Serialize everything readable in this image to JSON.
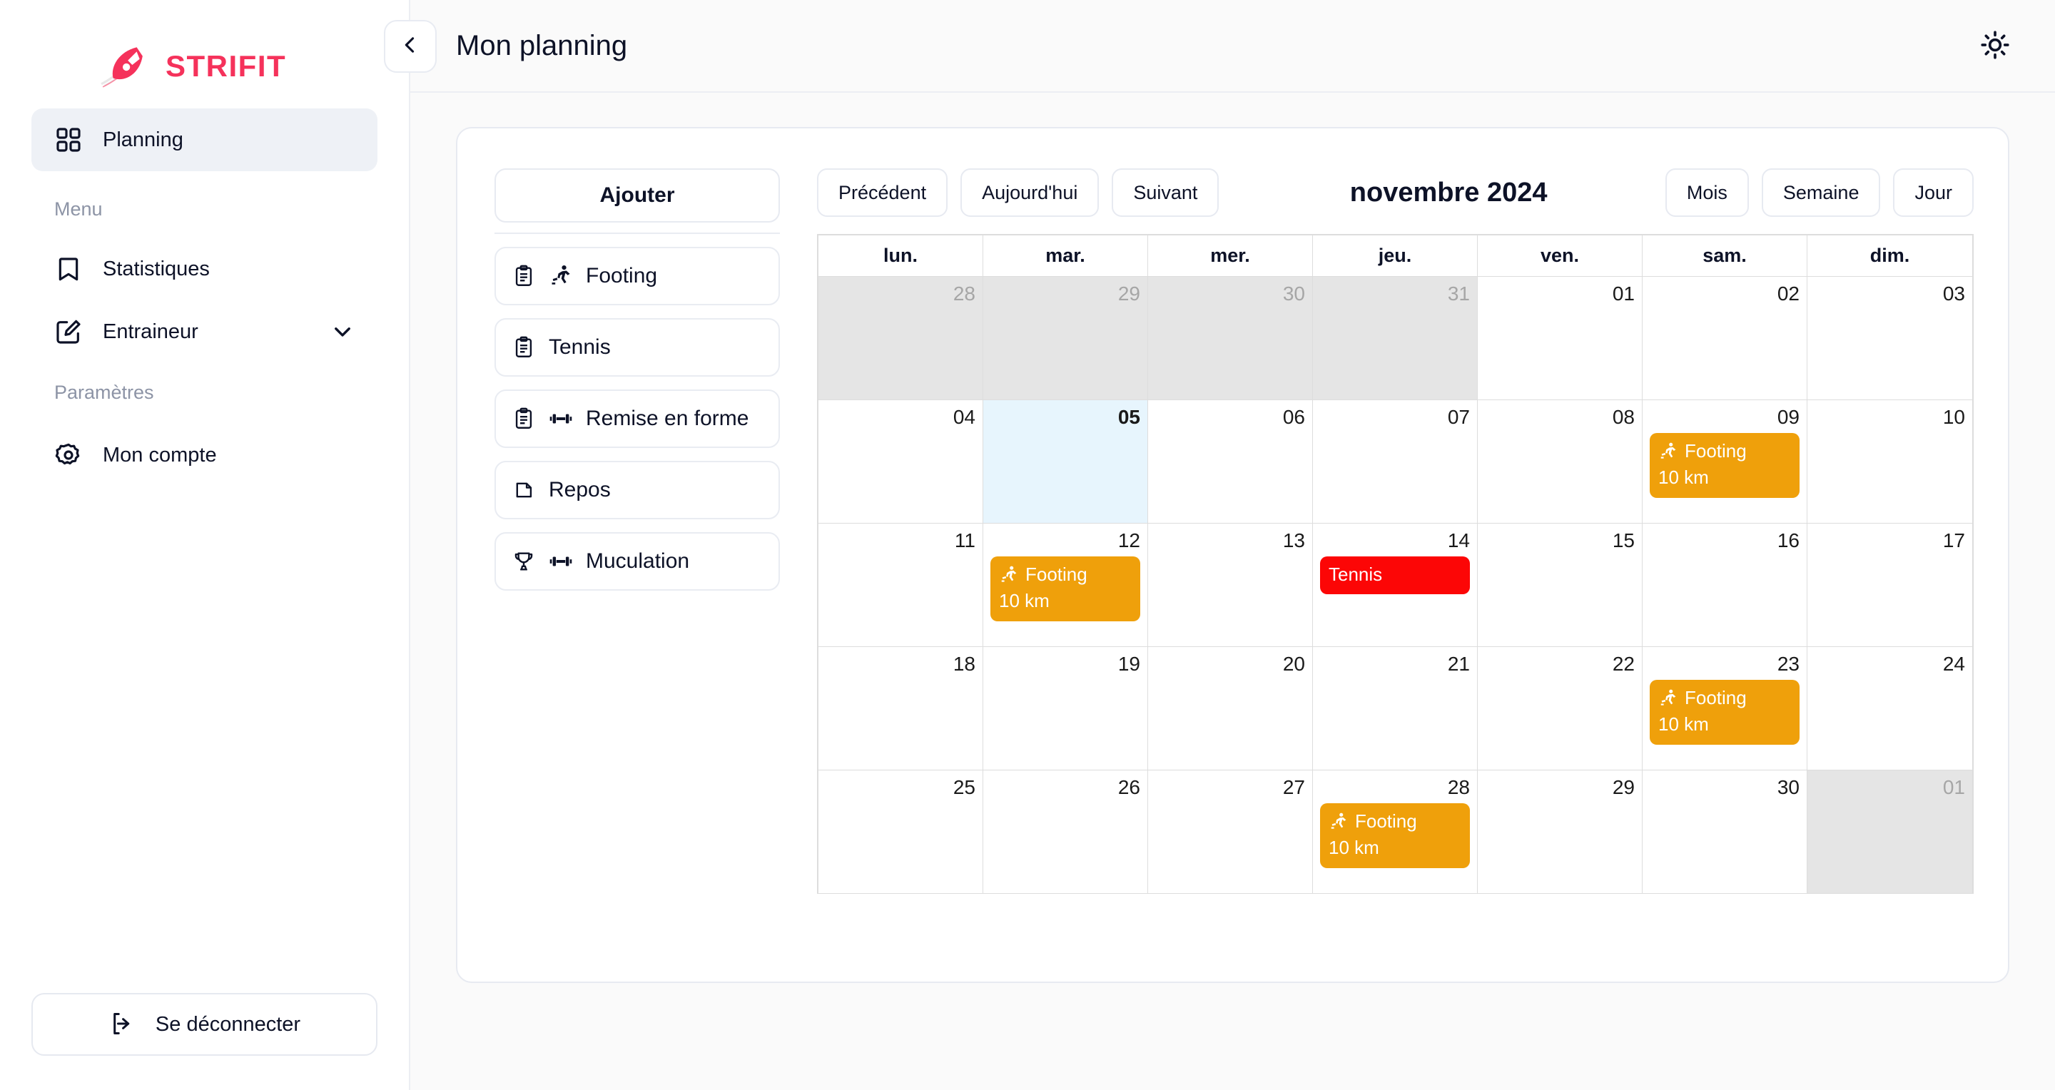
{
  "brand": {
    "name": "STRIFIT",
    "color": "#f5325b",
    "logo_icon": "strifit-rocket-logo"
  },
  "sidebar": {
    "primary": [
      {
        "label": "Planning",
        "icon": "grid-icon",
        "active": true
      }
    ],
    "menu_label": "Menu",
    "menu_items": [
      {
        "label": "Statistiques",
        "icon": "bookmark-icon"
      },
      {
        "label": "Entraineur",
        "icon": "edit-square-icon",
        "chevron": "chevron-down-icon"
      }
    ],
    "settings_label": "Paramètres",
    "settings_items": [
      {
        "label": "Mon compte",
        "icon": "gear-icon"
      }
    ],
    "logout": {
      "label": "Se déconnecter",
      "icon": "logout-icon"
    }
  },
  "topbar": {
    "collapse_icon": "chevron-left-icon",
    "title": "Mon planning",
    "theme_toggle_icon": "sun-icon"
  },
  "activity_panel": {
    "add_label": "Ajouter",
    "items": [
      {
        "label": "Footing",
        "icons": [
          "clipboard-icon",
          "running-icon"
        ]
      },
      {
        "label": "Tennis",
        "icons": [
          "clipboard-icon"
        ]
      },
      {
        "label": "Remise en forme",
        "icons": [
          "clipboard-icon",
          "dumbbell-icon"
        ]
      },
      {
        "label": "Repos",
        "icons": [
          "file-icon"
        ]
      },
      {
        "label": "Muculation",
        "icons": [
          "trophy-icon",
          "dumbbell-icon"
        ]
      }
    ]
  },
  "calendar": {
    "nav": {
      "prev": "Précédent",
      "today": "Aujourd'hui",
      "next": "Suivant"
    },
    "title": "novembre 2024",
    "views": [
      "Mois",
      "Semaine",
      "Jour"
    ],
    "day_headers": [
      "lun.",
      "mar.",
      "mer.",
      "jeu.",
      "ven.",
      "sam.",
      "dim."
    ],
    "colors": {
      "footing": "#efa00b",
      "tennis": "#fc0606",
      "today_bg": "#e7f5fd",
      "other_month_bg": "#e5e5e5"
    },
    "weeks": [
      [
        {
          "day": "28",
          "other": true
        },
        {
          "day": "29",
          "other": true
        },
        {
          "day": "30",
          "other": true
        },
        {
          "day": "31",
          "other": true
        },
        {
          "day": "01"
        },
        {
          "day": "02"
        },
        {
          "day": "03"
        }
      ],
      [
        {
          "day": "04"
        },
        {
          "day": "05",
          "today": true
        },
        {
          "day": "06"
        },
        {
          "day": "07"
        },
        {
          "day": "08"
        },
        {
          "day": "09",
          "event": {
            "title": "Footing",
            "sub": "10 km",
            "color": "#efa00b",
            "icon": "running-icon"
          }
        },
        {
          "day": "10"
        }
      ],
      [
        {
          "day": "11"
        },
        {
          "day": "12",
          "event": {
            "title": "Footing",
            "sub": "10 km",
            "color": "#efa00b",
            "icon": "running-icon"
          }
        },
        {
          "day": "13"
        },
        {
          "day": "14",
          "event": {
            "title": "Tennis",
            "sub": "",
            "color": "#fc0606",
            "icon": ""
          }
        },
        {
          "day": "15"
        },
        {
          "day": "16"
        },
        {
          "day": "17"
        }
      ],
      [
        {
          "day": "18"
        },
        {
          "day": "19"
        },
        {
          "day": "20"
        },
        {
          "day": "21"
        },
        {
          "day": "22"
        },
        {
          "day": "23",
          "event": {
            "title": "Footing",
            "sub": "10 km",
            "color": "#efa00b",
            "icon": "running-icon"
          }
        },
        {
          "day": "24"
        }
      ],
      [
        {
          "day": "25"
        },
        {
          "day": "26"
        },
        {
          "day": "27"
        },
        {
          "day": "28",
          "event": {
            "title": "Footing",
            "sub": "10 km",
            "color": "#efa00b",
            "icon": "running-icon"
          }
        },
        {
          "day": "29"
        },
        {
          "day": "30"
        },
        {
          "day": "01",
          "other": true
        }
      ]
    ]
  }
}
